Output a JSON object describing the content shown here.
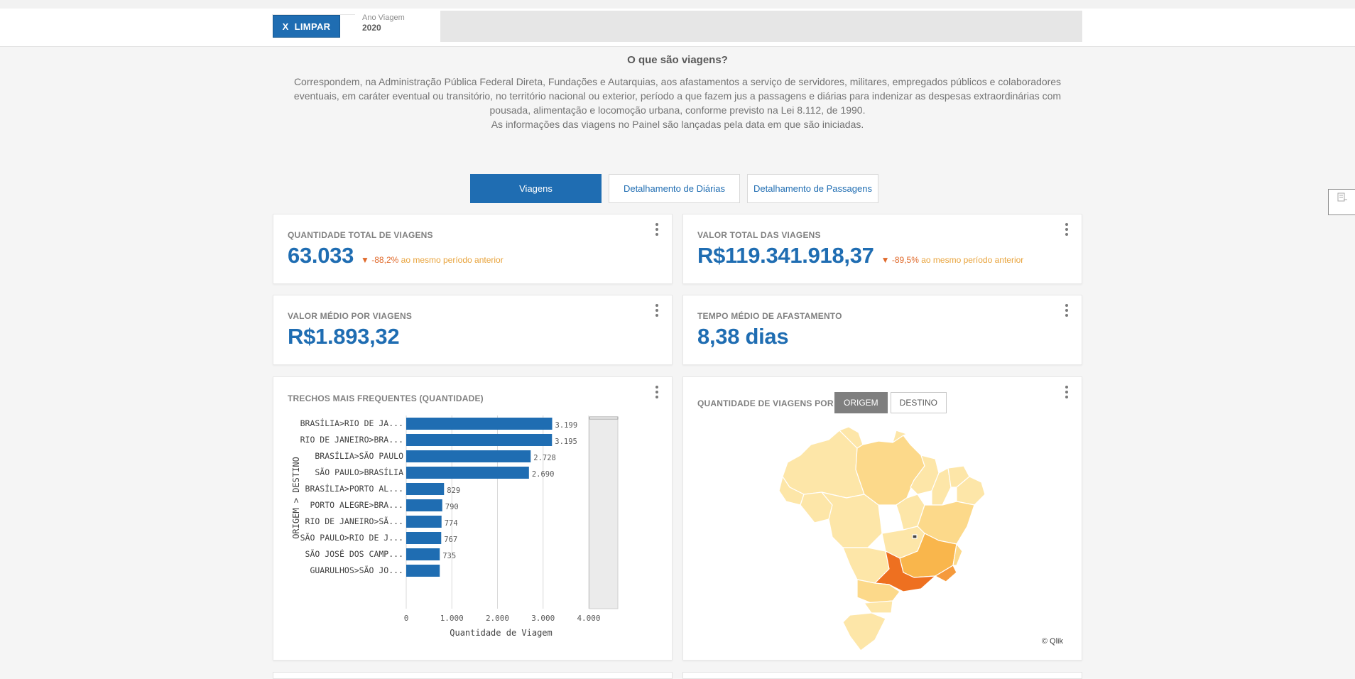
{
  "toolbar": {
    "clear_label": "LIMPAR",
    "clear_icon": "x-icon",
    "filter_label": "Ano Viagem",
    "filter_value": "2020"
  },
  "intro": {
    "title": "O que são viagens?",
    "line1": "Correspondem, na Administração Pública Federal Direta, Fundações e Autarquias, aos afastamentos a serviço de servidores, militares, empregados públicos e colaboradores",
    "line2": "eventuais, em caráter eventual ou transitório, no território nacional ou exterior, período a que fazem jus a passagens e diárias para indenizar as despesas extraordinárias com",
    "line3": "pousada, alimentação e locomoção urbana, conforme previsto na Lei 8.112, de 1990.",
    "line4": "As informações das viagens no Painel são lançadas pela data em que são iniciadas."
  },
  "tabs": [
    {
      "label": "Viagens",
      "active": true
    },
    {
      "label": "Detalhamento de Diárias",
      "active": false
    },
    {
      "label": "Detalhamento de Passagens",
      "active": false
    }
  ],
  "kpis": {
    "total_trips": {
      "title": "QUANTIDADE TOTAL DE VIAGENS",
      "value": "63.033",
      "delta_pct": "-88,2%",
      "delta_text": "ao mesmo período anterior"
    },
    "total_value": {
      "title": "VALOR TOTAL DAS VIAGENS",
      "value": "R$119.341.918,37",
      "delta_pct": "-89,5%",
      "delta_text": "ao mesmo período anterior"
    },
    "avg_value": {
      "title": "VALOR MÉDIO POR VIAGENS",
      "value": "R$1.893,32"
    },
    "avg_time": {
      "title": "TEMPO MÉDIO DE AFASTAMENTO",
      "value": "8,38 dias"
    }
  },
  "routes_card": {
    "title": "TRECHOS MAIS FREQUENTES (QUANTIDADE)"
  },
  "map_card": {
    "title": "QUANTIDADE DE VIAGENS POR",
    "origin_label": "ORIGEM",
    "destination_label": "DESTINO",
    "credit": "© Qlik"
  },
  "colors": {
    "accent": "#1f6db2",
    "bar": "#1f6db2",
    "delta_down": "#e06a2b",
    "map_low": "#fde6a8",
    "map_mid": "#f9b64c",
    "map_high": "#ee7020"
  },
  "chart_data": {
    "type": "bar",
    "orientation": "horizontal",
    "categories": [
      "BRASÍLIA>RIO DE JA...",
      "RIO DE JANEIRO>BRA...",
      "BRASÍLIA>SÃO PAULO",
      "SÃO PAULO>BRASÍLIA",
      "BRASÍLIA>PORTO AL...",
      "PORTO ALEGRE>BRA...",
      "RIO DE JANEIRO>SÃ...",
      "SÃO PAULO>RIO DE J...",
      "SÃO JOSÉ DOS CAMP...",
      "GUARULHOS>SÃO JO..."
    ],
    "values": [
      3199,
      3195,
      2728,
      2690,
      829,
      790,
      774,
      767,
      735,
      735
    ],
    "value_labels": [
      "3.199",
      "3.195",
      "2.728",
      "2.690",
      "829",
      "790",
      "774",
      "767",
      "735",
      ""
    ],
    "xlabel": "Quantidade de Viagem",
    "ylabel": "ORIGEM > DESTINO",
    "xlim": [
      0,
      4000
    ],
    "xticks": [
      "0",
      "1.000",
      "2.000",
      "3.000",
      "4.000"
    ],
    "grid": true
  }
}
